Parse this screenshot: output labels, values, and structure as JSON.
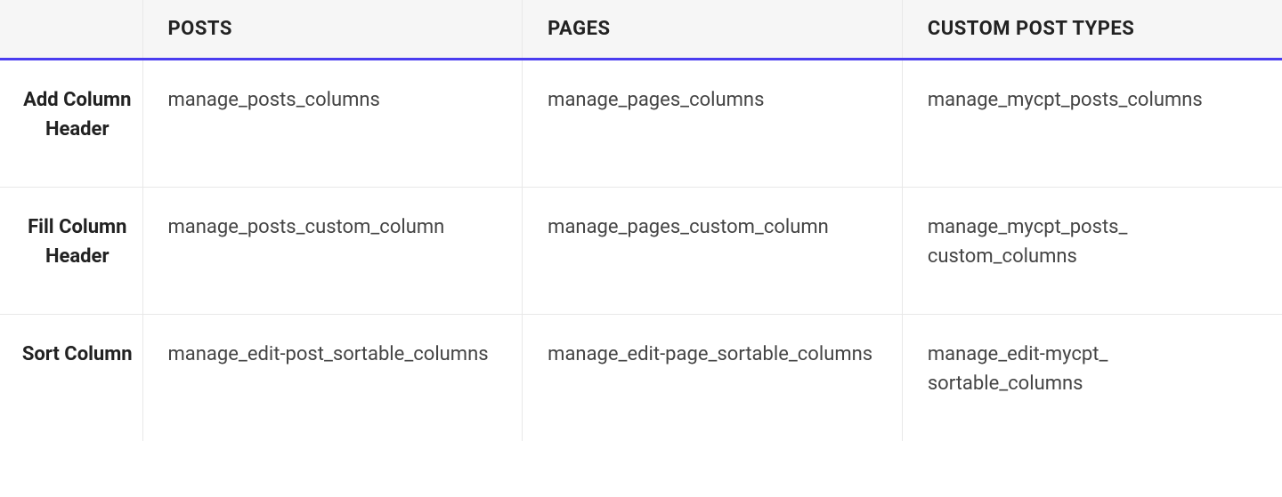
{
  "table": {
    "columns": [
      "POSTS",
      "PAGES",
      "CUSTOM POST TYPES"
    ],
    "rows": [
      {
        "label": "Add Column Header",
        "cells": [
          "manage_posts_columns",
          "manage_pages_columns",
          "manage_mycpt_posts_​columns"
        ]
      },
      {
        "label": "Fill Column Header",
        "cells": [
          "manage_posts_custom_​column",
          "manage_pages_custom_​column",
          "manage_mycpt_posts_​custom_columns"
        ]
      },
      {
        "label": "Sort Column",
        "cells": [
          "manage_edit-post_sortable​_columns",
          "manage_edit-page_sortable​_columns",
          "manage_edit-mycpt_​sortable_columns"
        ]
      }
    ]
  }
}
